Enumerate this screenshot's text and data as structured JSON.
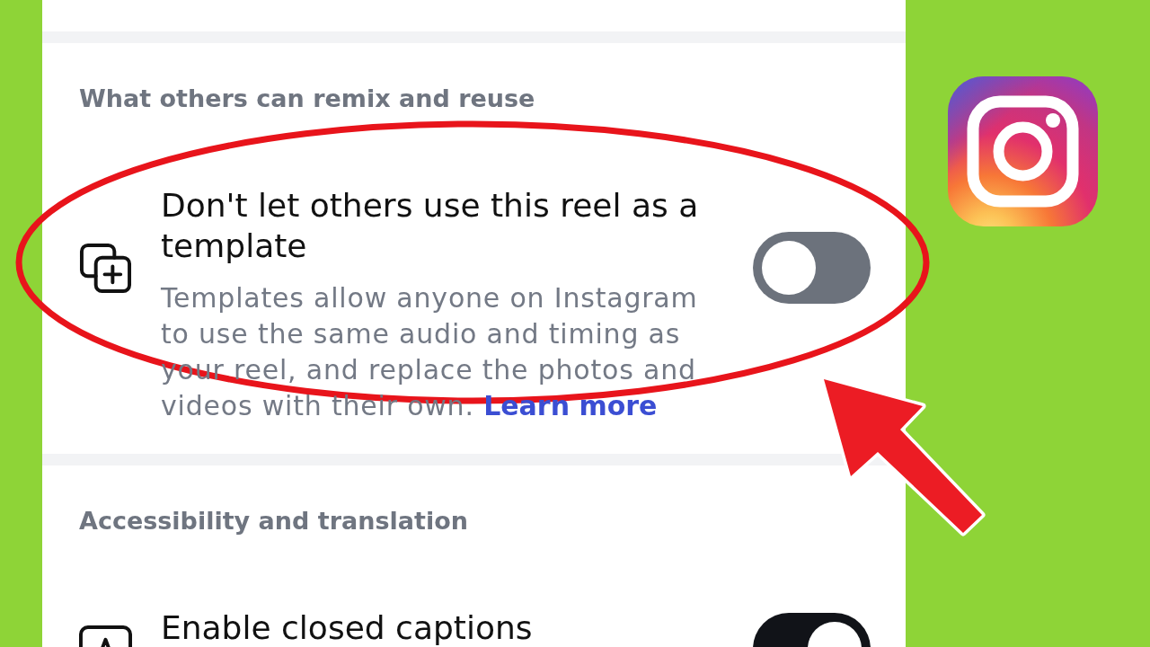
{
  "sections": [
    {
      "header": "What others can remix and reuse",
      "items": [
        {
          "kind": "template",
          "title": "Don't let others use this reel as a template",
          "description": "Templates allow anyone on Instagram to use the same audio and timing as your reel, and replace the photos and videos with their own.",
          "link": "Learn more",
          "on": false
        }
      ]
    },
    {
      "header": "Accessibility and translation",
      "items": [
        {
          "kind": "captions",
          "title": "Enable closed captions",
          "on": true
        }
      ]
    }
  ]
}
